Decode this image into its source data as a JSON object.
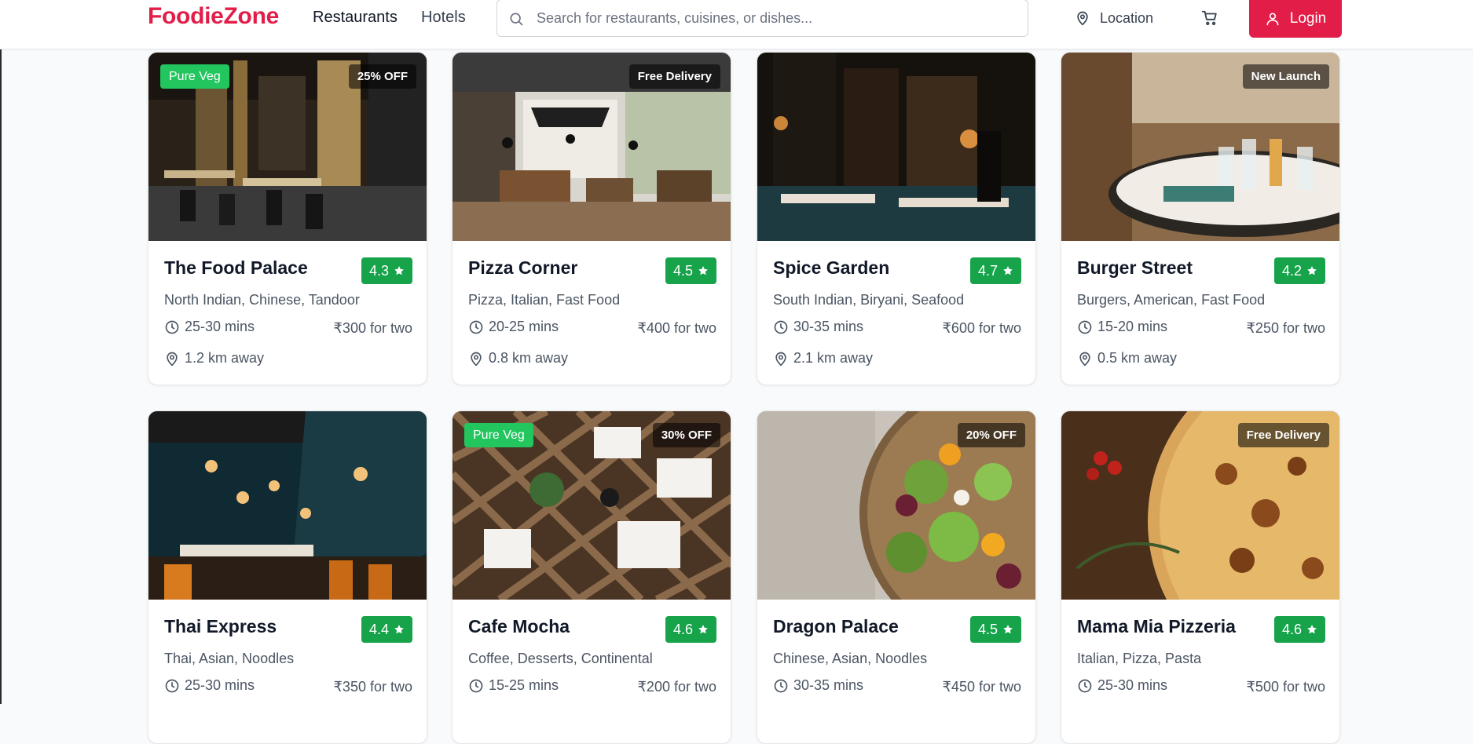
{
  "header": {
    "brand": "FoodieZone",
    "nav": [
      "Restaurants",
      "Hotels"
    ],
    "search_placeholder": "Search for restaurants, cuisines, or dishes...",
    "location_label": "Location",
    "login_label": "Login"
  },
  "colors": {
    "brand": "#e11d48",
    "rating_bg": "#16a34a",
    "pure_veg_badge": "#22c55e",
    "offer_badge": "rgba(0,0,0,0.55)"
  },
  "icons": {
    "search": "search-icon",
    "location": "map-pin-icon",
    "cart": "cart-icon",
    "user": "user-icon",
    "time": "clock-icon",
    "star": "star-icon"
  },
  "restaurants": [
    {
      "name": "The Food Palace",
      "rating": "4.3",
      "cuisines": "North Indian, Chinese, Tandoor",
      "time": "25-30 mins",
      "price": "₹300 for two",
      "distance": "1.2 km away",
      "badge_left": "Pure Veg",
      "badge_right": "25% OFF"
    },
    {
      "name": "Pizza Corner",
      "rating": "4.5",
      "cuisines": "Pizza, Italian, Fast Food",
      "time": "20-25 mins",
      "price": "₹400 for two",
      "distance": "0.8 km away",
      "badge_left": "",
      "badge_right": "Free Delivery"
    },
    {
      "name": "Spice Garden",
      "rating": "4.7",
      "cuisines": "South Indian, Biryani, Seafood",
      "time": "30-35 mins",
      "price": "₹600 for two",
      "distance": "2.1 km away",
      "badge_left": "",
      "badge_right": ""
    },
    {
      "name": "Burger Street",
      "rating": "4.2",
      "cuisines": "Burgers, American, Fast Food",
      "time": "15-20 mins",
      "price": "₹250 for two",
      "distance": "0.5 km away",
      "badge_left": "",
      "badge_right": "New Launch"
    },
    {
      "name": "Thai Express",
      "rating": "4.4",
      "cuisines": "Thai, Asian, Noodles",
      "time": "25-30 mins",
      "price": "₹350 for two",
      "distance": "",
      "badge_left": "",
      "badge_right": ""
    },
    {
      "name": "Cafe Mocha",
      "rating": "4.6",
      "cuisines": "Coffee, Desserts, Continental",
      "time": "15-25 mins",
      "price": "₹200 for two",
      "distance": "",
      "badge_left": "Pure Veg",
      "badge_right": "30% OFF"
    },
    {
      "name": "Dragon Palace",
      "rating": "4.5",
      "cuisines": "Chinese, Asian, Noodles",
      "time": "30-35 mins",
      "price": "₹450 for two",
      "distance": "",
      "badge_left": "",
      "badge_right": "20% OFF"
    },
    {
      "name": "Mama Mia Pizzeria",
      "rating": "4.6",
      "cuisines": "Italian, Pizza, Pasta",
      "time": "25-30 mins",
      "price": "₹500 for two",
      "distance": "",
      "badge_left": "",
      "badge_right": "Free Delivery"
    }
  ]
}
